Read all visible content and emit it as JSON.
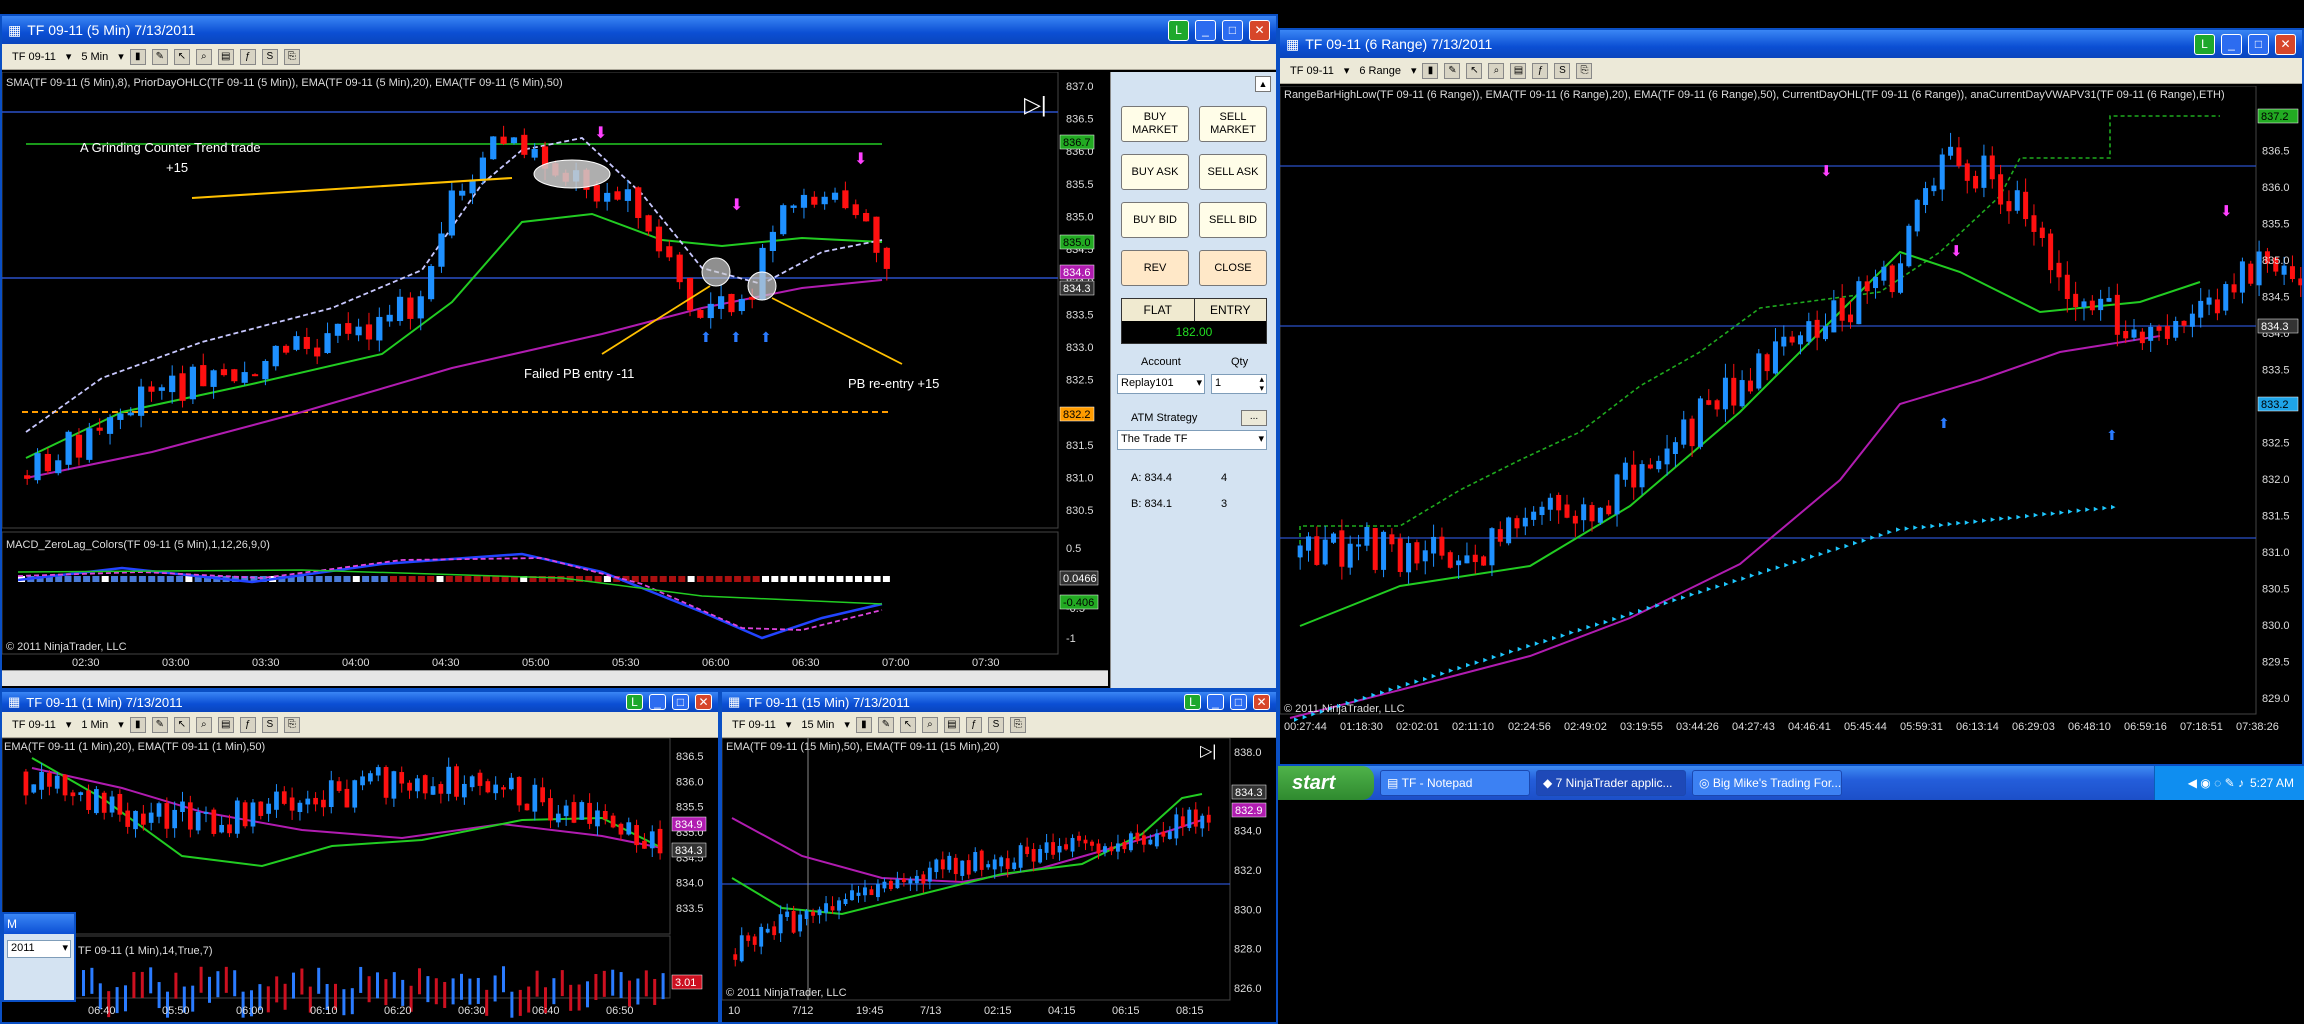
{
  "win_main": {
    "title": "TF 09-11 (5 Min)  7/13/2011",
    "toolbar": {
      "instrument": "TF 09-11",
      "period": "5 Min"
    },
    "indicator_label": "SMA(TF 09-11 (5 Min),8), PriorDayOHLC(TF 09-11 (5 Min)), EMA(TF 09-11 (5 Min),20), EMA(TF 09-11 (5 Min),50)",
    "annotations": {
      "trade_title": "A Grinding Counter Trend trade",
      "trade_result": "+15",
      "failed": "Failed PB entry -11",
      "reentry": "PB re-entry +15"
    },
    "price_axis": [
      "837.0",
      "836.5",
      "836.0",
      "835.5",
      "835.0",
      "834.5",
      "834.0",
      "833.5",
      "833.0",
      "832.5",
      "832.0",
      "831.5",
      "831.0",
      "830.5"
    ],
    "price_tags": [
      "836.7",
      "835.0",
      "834.6",
      "834.3",
      "832.2"
    ],
    "macd_label": "MACD_ZeroLag_Colors(TF 09-11 (5 Min),1,12,26,9,0)",
    "macd_axis": [
      "0.5",
      "0",
      "-0.5",
      "-1"
    ],
    "macd_tags": [
      "0.0466",
      "-0.406"
    ],
    "time_axis": [
      "02:30",
      "03:00",
      "03:30",
      "04:00",
      "04:30",
      "05:00",
      "05:30",
      "06:00",
      "06:30",
      "07:00",
      "07:30"
    ],
    "copyright": "© 2011 NinjaTrader, LLC"
  },
  "order_panel": {
    "buy_market": "BUY MARKET",
    "sell_market": "SELL MARKET",
    "buy_ask": "BUY ASK",
    "sell_ask": "SELL ASK",
    "buy_bid": "BUY BID",
    "sell_bid": "SELL BID",
    "rev": "REV",
    "close": "CLOSE",
    "position": "FLAT",
    "entry": "ENTRY",
    "pnl": "182.00",
    "account_label": "Account",
    "qty_label": "Qty",
    "account_value": "Replay101",
    "qty_value": "1",
    "atm_label": "ATM Strategy",
    "atm_value": "The Trade TF",
    "ask": "A: 834.4",
    "ask_size": "4",
    "bid": "B: 834.1",
    "bid_size": "3"
  },
  "win_range": {
    "title": "TF 09-11 (6 Range)  7/13/2011",
    "toolbar": {
      "instrument": "TF 09-11",
      "period": "6 Range"
    },
    "indicator_label": "RangeBarHighLow(TF 09-11 (6 Range)), EMA(TF 09-11 (6 Range),20), EMA(TF 09-11 (6 Range),50), CurrentDayOHL(TF 09-11 (6 Range)), anaCurrentDayVWAPV31(TF 09-11 (6 Range),ETH)",
    "price_axis": [
      "837.0",
      "836.5",
      "836.0",
      "835.5",
      "835.0",
      "834.5",
      "834.0",
      "833.5",
      "833.0",
      "832.5",
      "832.0",
      "831.5",
      "831.0",
      "830.5",
      "830.0",
      "829.5",
      "829.0"
    ],
    "price_tags": [
      "837.2",
      "834.3",
      "833.2"
    ],
    "time_axis": [
      "00:27:44",
      "01:18:30",
      "02:02:01",
      "02:11:10",
      "02:24:56",
      "02:49:02",
      "03:19:55",
      "03:44:26",
      "04:27:43",
      "04:46:41",
      "05:45:44",
      "05:59:31",
      "06:13:14",
      "06:29:03",
      "06:48:10",
      "06:59:16",
      "07:18:51",
      "07:38:26"
    ],
    "copyright": "© 2011 NinjaTrader, LLC"
  },
  "win_1min": {
    "title": "TF 09-11 (1 Min)  7/13/2011",
    "toolbar": {
      "instrument": "TF 09-11",
      "period": "1 Min"
    },
    "indicator_label": "EMA(TF 09-11 (1 Min),20), EMA(TF 09-11 (1 Min),50)",
    "price_axis": [
      "836.5",
      "836.0",
      "835.5",
      "835.0",
      "834.5",
      "834.0",
      "833.5"
    ],
    "price_tags": [
      "834.9",
      "834.3"
    ],
    "sub_label": "TF 09-11 (1 Min),14,True,7)",
    "sub_axis": [
      "50"
    ],
    "sub_tag": "3.01",
    "time_axis": [
      "06:40",
      "05:50",
      "06:00",
      "06:10",
      "06:20",
      "06:30",
      "06:40",
      "06:50"
    ],
    "copyright": "ader, LLC"
  },
  "win_15min": {
    "title": "TF 09-11 (15 Min)  7/13/2011",
    "toolbar": {
      "instrument": "TF 09-11",
      "period": "15 Min"
    },
    "indicator_label": "EMA(TF 09-11 (15 Min),50), EMA(TF 09-11 (15 Min),20)",
    "price_axis": [
      "838.0",
      "836.0",
      "834.0",
      "832.0",
      "830.0",
      "828.0",
      "826.0"
    ],
    "price_tags": [
      "834.3",
      "832.9"
    ],
    "time_axis": [
      "10",
      "7/12",
      "19:45",
      "7/13",
      "02:15",
      "04:15",
      "06:15",
      "08:15"
    ],
    "copyright": "© 2011 NinjaTrader, LLC"
  },
  "partial_window": {
    "title": "M",
    "value": "2011"
  },
  "taskbar": {
    "start": "start",
    "tasks": [
      "TF - Notepad",
      "7 NinjaTrader applic...",
      "Big Mike's Trading For..."
    ],
    "clock": "5:27 AM"
  },
  "colors": {
    "up_candle": "#1e90ff",
    "down_candle": "#ff1010",
    "ema20": "#22cc22",
    "ema50": "#b01cb0",
    "sma8": "#c8c8ff",
    "level_line": "#2a50c8",
    "prior_low": "#ff9c00",
    "vwap_dots": "#1ec8ff"
  }
}
